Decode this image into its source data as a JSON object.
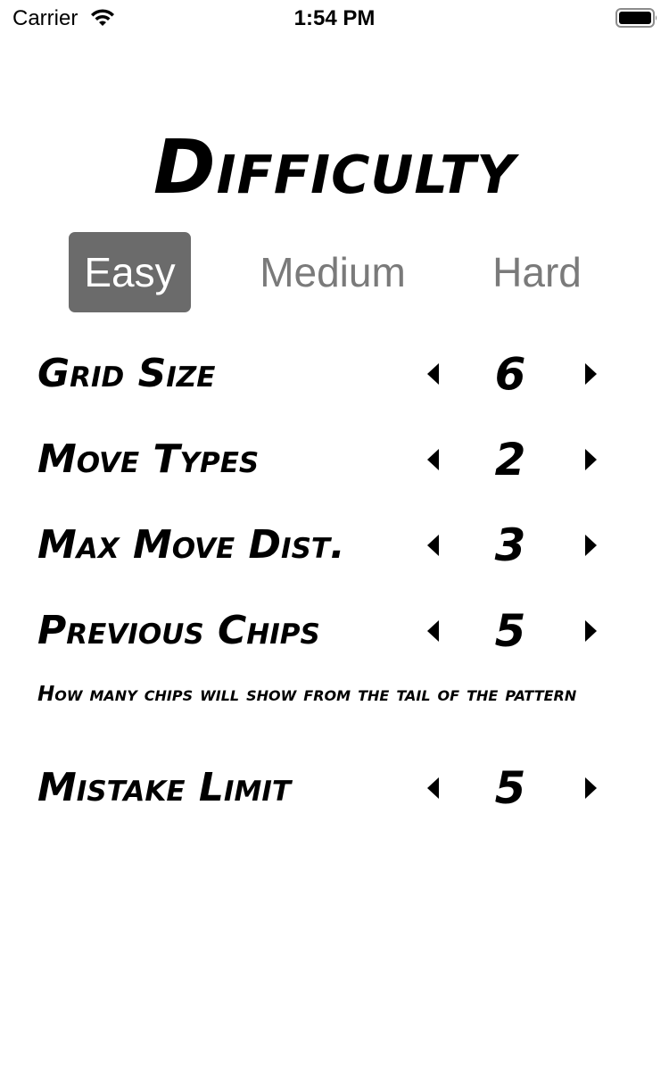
{
  "status_bar": {
    "carrier": "Carrier",
    "time": "1:54 PM",
    "icons": [
      "wifi-icon",
      "battery-icon"
    ]
  },
  "title": "Difficulty",
  "difficulty_segments": {
    "options": [
      "Easy",
      "Medium",
      "Hard"
    ],
    "selected": "Easy"
  },
  "settings": {
    "grid_size": {
      "label": "Grid Size",
      "value": "6"
    },
    "move_types": {
      "label": "Move Types",
      "value": "2"
    },
    "max_move_dist": {
      "label": "Max Move Dist.",
      "value": "3"
    },
    "previous_chips": {
      "label": "Previous Chips",
      "value": "5",
      "hint": "How many chips will show from the tail of the pattern"
    },
    "mistake_limit": {
      "label": "Mistake Limit",
      "value": "5"
    }
  },
  "icons": {
    "decrease": "caret-left-icon",
    "increase": "caret-right-icon"
  },
  "colors": {
    "selected_segment_bg": "#6b6b6b",
    "unselected_segment_text": "#7a7a7a",
    "text": "#000000",
    "background": "#ffffff"
  }
}
